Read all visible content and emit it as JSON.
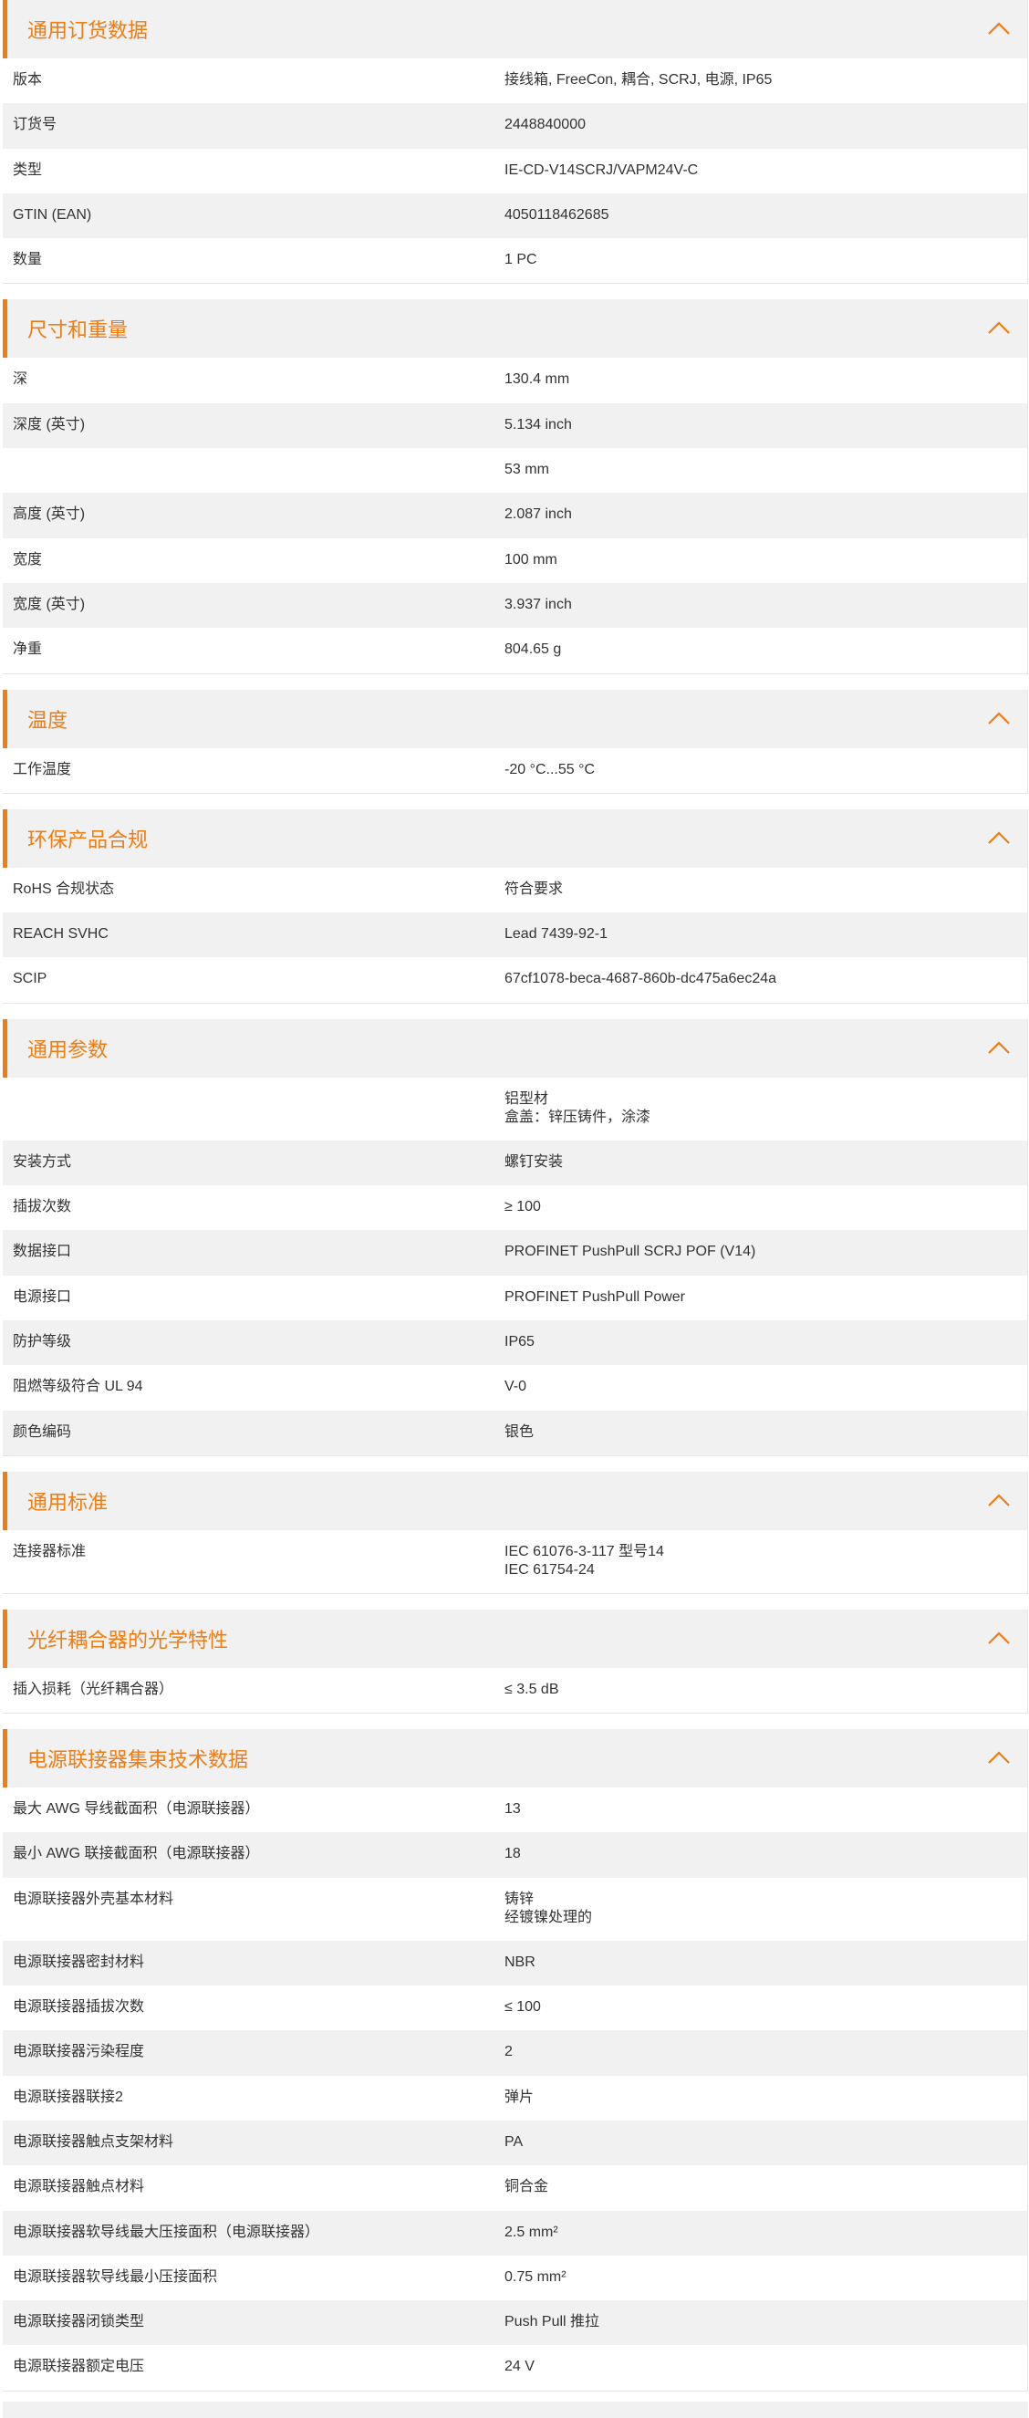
{
  "accent_color": "#ef7d13",
  "collapse_icon": "chevron-up-icon",
  "sections": [
    {
      "title": "通用订货数据",
      "rows": [
        {
          "label": "版本",
          "value": "接线箱, FreeCon, 耦合, SCRJ, 电源, IP65"
        },
        {
          "label": "订货号",
          "value": "2448840000"
        },
        {
          "label": "类型",
          "value": "IE-CD-V14SCRJ/VAPM24V-C"
        },
        {
          "label": "GTIN (EAN)",
          "value": "4050118462685"
        },
        {
          "label": "数量",
          "value": "1  PC"
        }
      ]
    },
    {
      "title": "尺寸和重量",
      "rows": [
        {
          "label": "深",
          "value": "130.4  mm"
        },
        {
          "label": "深度 (英寸)",
          "value": "5.134  inch"
        },
        {
          "label": "",
          "value": "53  mm"
        },
        {
          "label": "高度 (英寸)",
          "value": "2.087  inch"
        },
        {
          "label": "宽度",
          "value": "100  mm"
        },
        {
          "label": "宽度 (英寸)",
          "value": "3.937  inch"
        },
        {
          "label": "净重",
          "value": "804.65  g"
        }
      ]
    },
    {
      "title": "温度",
      "rows": [
        {
          "label": "工作温度",
          "value": "-20 °C...55 °C"
        }
      ]
    },
    {
      "title": "环保产品合规",
      "rows": [
        {
          "label": "RoHS 合规状态",
          "value": "符合要求"
        },
        {
          "label": "REACH SVHC",
          "value": "Lead 7439-92-1"
        },
        {
          "label": "SCIP",
          "value": "67cf1078-beca-4687-860b-dc475a6ec24a"
        }
      ]
    },
    {
      "title": "通用参数",
      "rows": [
        {
          "label": "",
          "value": "铝型材\n盒盖：锌压铸件，涂漆"
        },
        {
          "label": "安装方式",
          "value": "螺钉安装"
        },
        {
          "label": "插拔次数",
          "value": "≥ 100"
        },
        {
          "label": "数据接口",
          "value": "PROFINET PushPull SCRJ POF (V14)"
        },
        {
          "label": "电源接口",
          "value": "PROFINET PushPull Power"
        },
        {
          "label": "防护等级",
          "value": "IP65"
        },
        {
          "label": "阻燃等级符合 UL 94",
          "value": "V-0"
        },
        {
          "label": "颜色编码",
          "value": "银色"
        }
      ]
    },
    {
      "title": "通用标准",
      "rows": [
        {
          "label": "连接器标准",
          "value": "IEC 61076-3-117 型号14\nIEC 61754-24"
        }
      ]
    },
    {
      "title": "光纤耦合器的光学特性",
      "rows": [
        {
          "label": "插入损耗（光纤耦合器）",
          "value": "≤ 3.5 dB"
        }
      ]
    },
    {
      "title": "电源联接器集束技术数据",
      "rows": [
        {
          "label": "最大 AWG 导线截面积（电源联接器）",
          "value": "13"
        },
        {
          "label": "最小 AWG 联接截面积（电源联接器）",
          "value": "18"
        },
        {
          "label": "电源联接器外壳基本材料",
          "value": "铸锌\n经镀镍处理的"
        },
        {
          "label": "电源联接器密封材料",
          "value": "NBR"
        },
        {
          "label": "电源联接器插拔次数",
          "value": "≤ 100"
        },
        {
          "label": "电源联接器污染程度",
          "value": "2"
        },
        {
          "label": "电源联接器联接2",
          "value": "弹片"
        },
        {
          "label": "电源联接器触点支架材料",
          "value": "PA"
        },
        {
          "label": "电源联接器触点材料",
          "value": "铜合金"
        },
        {
          "label": "电源联接器软导线最大压接面积（电源联接器）",
          "value": "2.5  mm²"
        },
        {
          "label": "电源联接器软导线最小压接面积",
          "value": "0.75  mm²"
        },
        {
          "label": "电源联接器闭锁类型",
          "value": "Push Pull 推拉"
        },
        {
          "label": "电源联接器额定电压",
          "value": "24  V"
        }
      ]
    }
  ]
}
